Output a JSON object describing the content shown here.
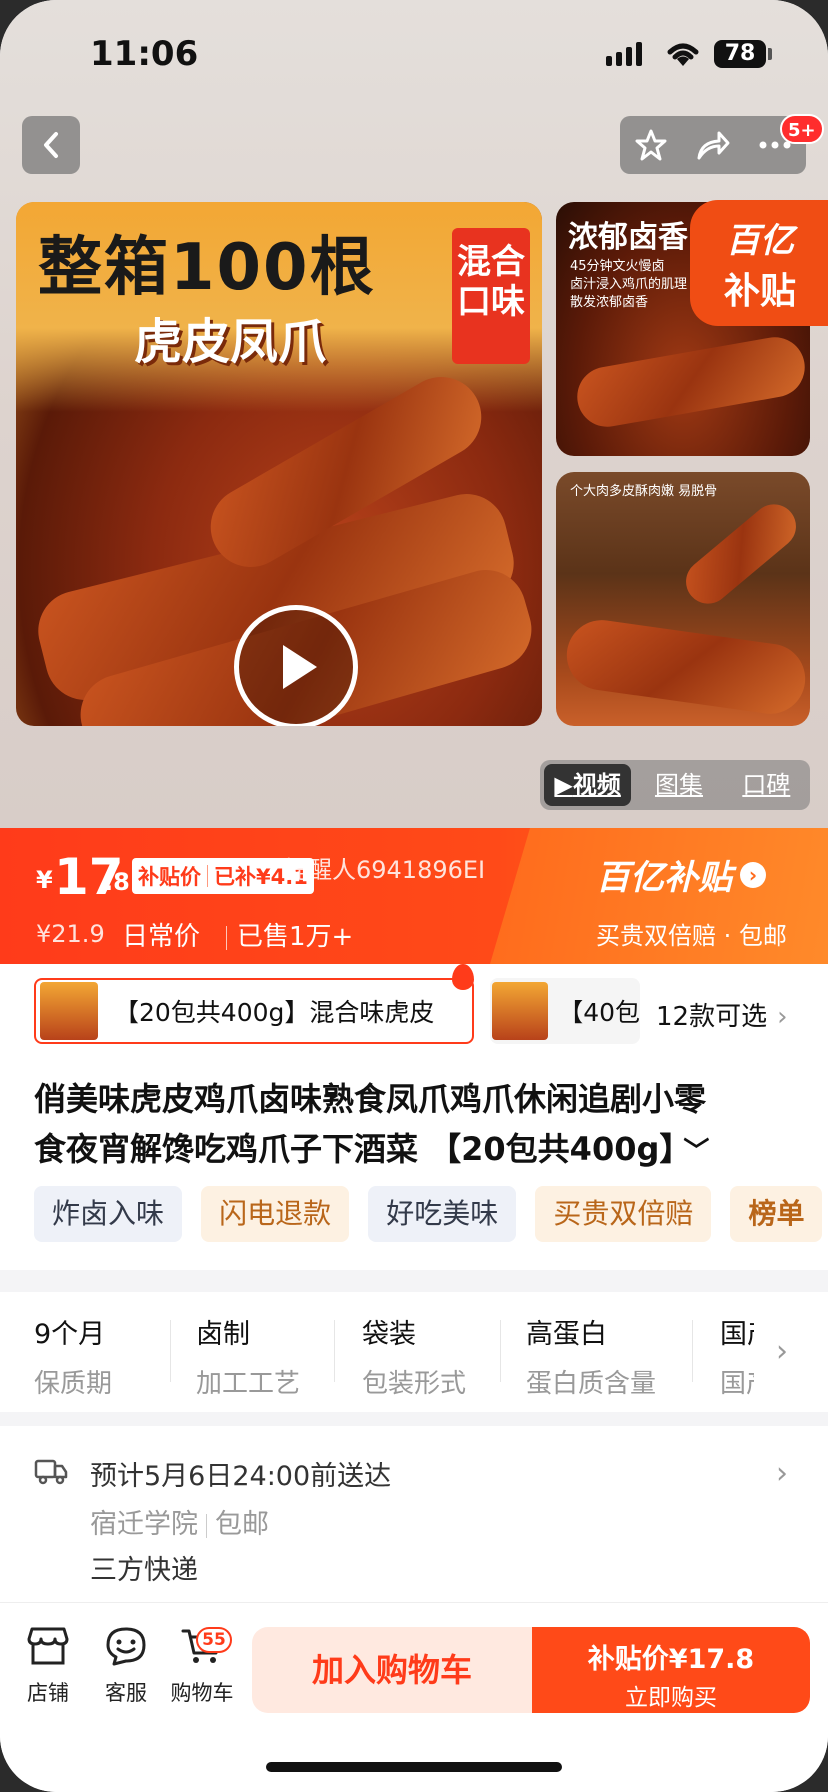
{
  "status_bar": {
    "time": "11:06",
    "battery": "78"
  },
  "nav": {
    "badge": "5+"
  },
  "gallery": {
    "main": {
      "title": "整箱100根",
      "subtitle": "虎皮凤爪",
      "badge": "混合口味"
    },
    "thumb1": {
      "title": "浓郁卤香",
      "caption": "45分钟文火慢卤\n卤汁浸入鸡爪的肌理\n散发浓郁卤香"
    },
    "thumb2": {
      "caption": "个大肉多皮酥肉嫩 易脱骨"
    },
    "subsidy_tag": {
      "line1": "百亿",
      "line2": "补贴"
    },
    "media_tabs": [
      "视频",
      "图集",
      "口碑"
    ]
  },
  "price": {
    "currency": "¥",
    "integer": "17",
    "decimal": ".8",
    "pill_label": "补贴价",
    "pill_saved": "已补¥4.1",
    "danmaku": "提醒人6941896EI",
    "original": "¥21.9",
    "daily_label": "日常价",
    "sold": "已售1万+",
    "brand": "百亿补贴",
    "brand_sub": "买贵双倍赔 · 包邮"
  },
  "sku": {
    "selected": "【20包共400g】混合味虎皮",
    "second": "【40包",
    "more": "12款可选"
  },
  "title": {
    "line1": "俏美味虎皮鸡爪卤味熟食凤爪鸡爪休闲追剧小零",
    "line2": "食夜宵解馋吃鸡爪子下酒菜 【20包共400g】"
  },
  "tags": [
    {
      "label": "炸卤入味",
      "style": "blue"
    },
    {
      "label": "闪电退款",
      "style": "orange"
    },
    {
      "label": "好吃美味",
      "style": "blue"
    },
    {
      "label": "买贵双倍赔",
      "style": "orange"
    },
    {
      "label": "榜单",
      "style": "orange"
    }
  ],
  "params": [
    {
      "value": "9个月",
      "key": "保质期"
    },
    {
      "value": "卤制",
      "key": "加工工艺"
    },
    {
      "value": "袋装",
      "key": "包装形式"
    },
    {
      "value": "高蛋白",
      "key": "蛋白质含量"
    },
    {
      "value": "国产",
      "key": "国产"
    }
  ],
  "delivery": {
    "eta": "预计5月6日24:00前送达",
    "location": "宿迁学院",
    "shipping": "包邮",
    "carrier": "三方快递"
  },
  "bottom": {
    "shop": "店铺",
    "service": "客服",
    "cart": "购物车",
    "cart_count": "55",
    "add_cart": "加入购物车",
    "buy_price": "补贴价¥17.8",
    "buy_label": "立即购买"
  },
  "colors": {
    "accent": "#ff3b1a",
    "accent_orange": "#ff7a1c",
    "tag_orange_bg": "#fdf1e2"
  }
}
